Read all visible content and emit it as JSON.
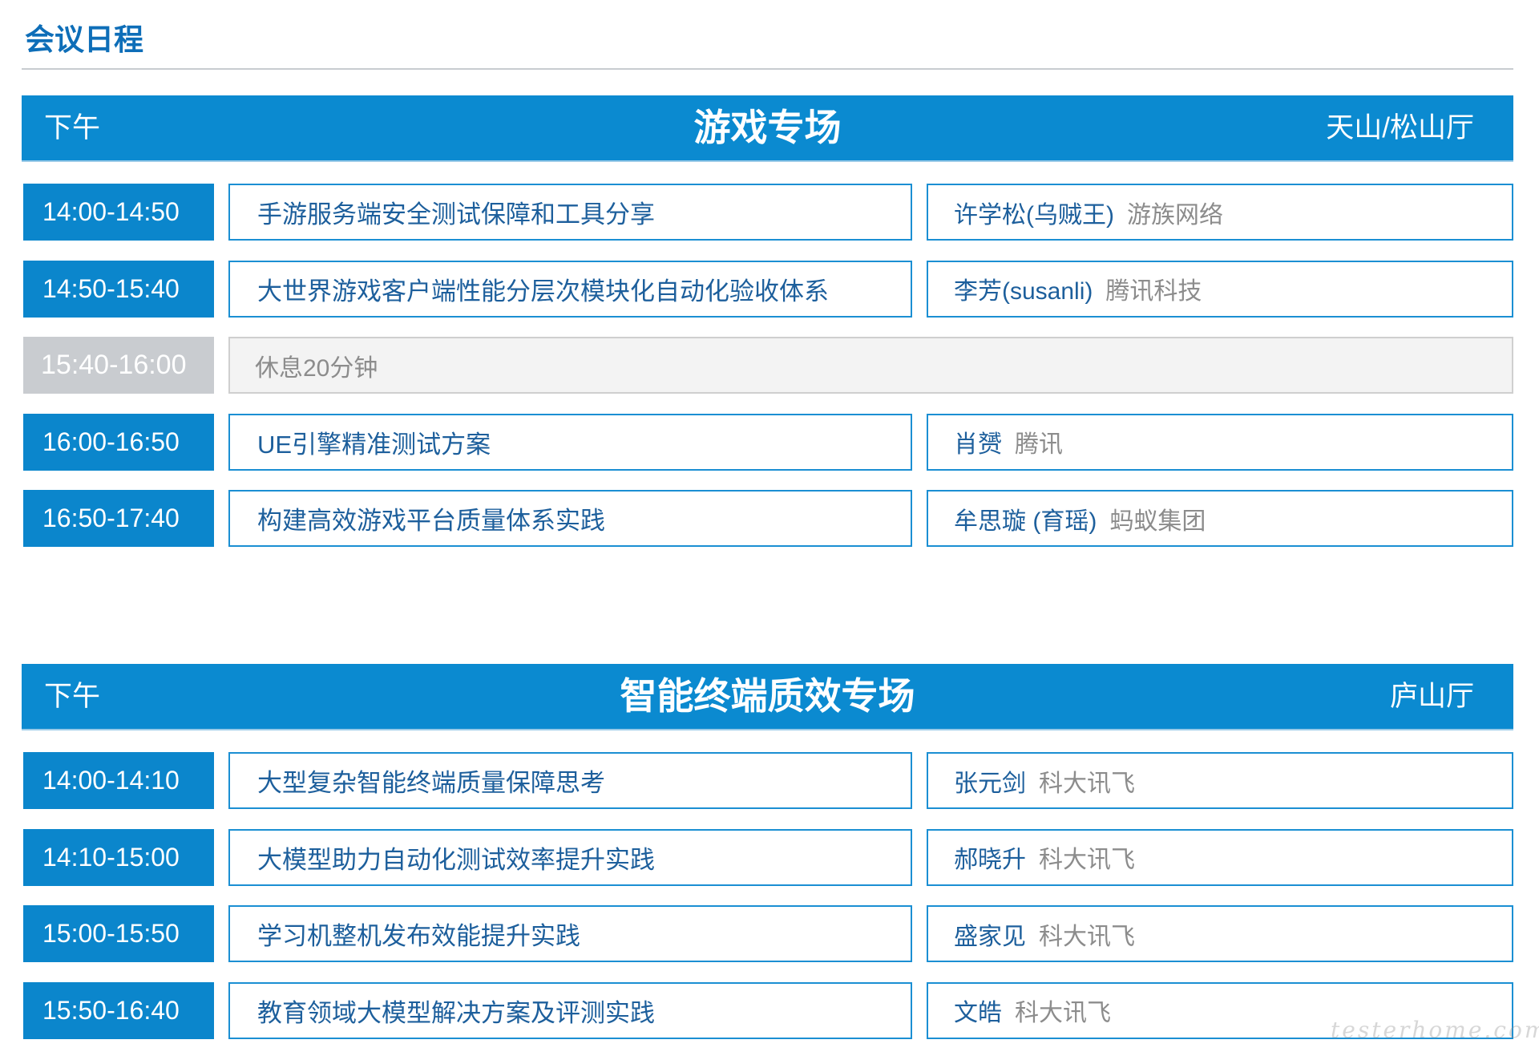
{
  "header": {
    "title": "会议日程"
  },
  "sessions": [
    {
      "period": "下午",
      "name": "游戏专场",
      "room": "天山/松山厅",
      "items": [
        {
          "time": "14:00-14:50",
          "topic": "手游服务端安全测试保障和工具分享",
          "speaker": "许学松(乌贼王)",
          "company": "游族网络"
        },
        {
          "time": "14:50-15:40",
          "topic": "大世界游戏客户端性能分层次模块化自动化验收体系",
          "speaker": "李芳(susanli)",
          "company": "腾讯科技"
        },
        {
          "time": "15:40-16:00",
          "break": "休息20分钟"
        },
        {
          "time": "16:00-16:50",
          "topic": "UE引擎精准测试方案",
          "speaker": "肖赟",
          "company": "腾讯"
        },
        {
          "time": "16:50-17:40",
          "topic": "构建高效游戏平台质量体系实践",
          "speaker": "牟思璇 (育瑶)",
          "company": "蚂蚁集团"
        }
      ]
    },
    {
      "period": "下午",
      "name": "智能终端质效专场",
      "room": "庐山厅",
      "items": [
        {
          "time": "14:00-14:10",
          "topic": "大型复杂智能终端质量保障思考",
          "speaker": "张元剑",
          "company": "科大讯飞"
        },
        {
          "time": "14:10-15:00",
          "topic": "大模型助力自动化测试效率提升实践",
          "speaker": "郝晓升",
          "company": "科大讯飞"
        },
        {
          "time": "15:00-15:50",
          "topic": "学习机整机发布效能提升实践",
          "speaker": "盛家见",
          "company": "科大讯飞"
        },
        {
          "time": "15:50-16:40",
          "topic": "教育领域大模型解决方案及评测实践",
          "speaker": "文皓",
          "company": "科大讯飞"
        }
      ]
    }
  ],
  "watermark": "testerhome.com",
  "colors": {
    "accent": "#0b8ad0",
    "time_bg": "#0b86cc",
    "title": "#0e6eb8",
    "text": "#1d5f9c",
    "muted": "#8c8c8c",
    "border": "#1b8fd3",
    "break_bg": "#f3f3f3",
    "break_time": "#c9ccd0"
  }
}
